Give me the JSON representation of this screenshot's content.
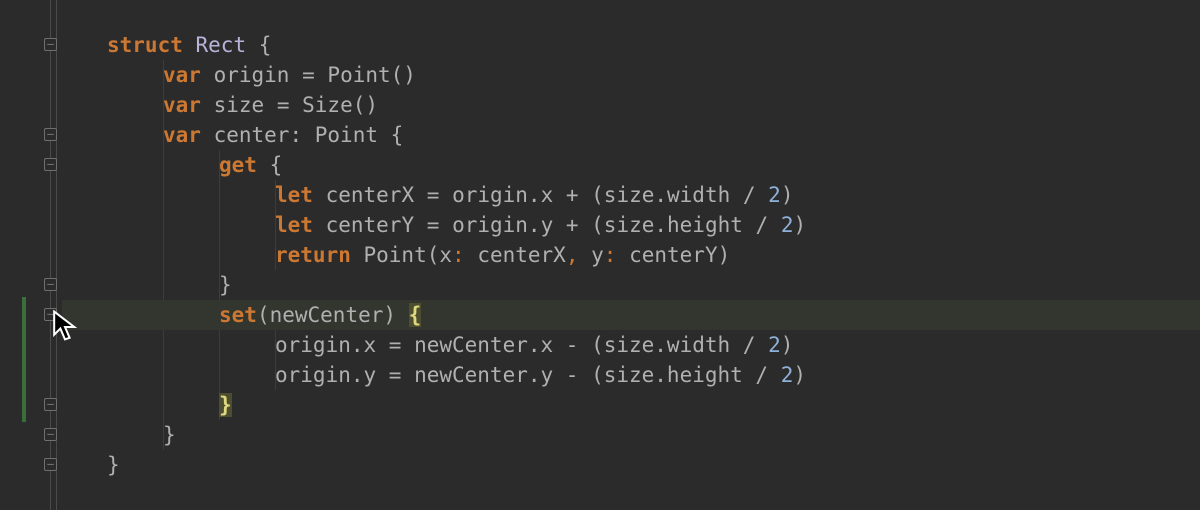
{
  "code": {
    "l1_struct": "struct",
    "l1_type": "Rect",
    "l1_brace": "{",
    "l2_var": "var",
    "l2_name": "origin",
    "l2_eq": "=",
    "l2_call": "Point()",
    "l3_var": "var",
    "l3_name": "size",
    "l3_eq": "=",
    "l3_call": "Size()",
    "l4_var": "var",
    "l4_name": "center",
    "l4_colon": ":",
    "l4_type": "Point",
    "l4_brace": "{",
    "l5_get": "get",
    "l5_brace": "{",
    "l6_let": "let",
    "l6_name": "centerX",
    "l6_eq": "=",
    "l6_expr": "origin.x + (size.width / ",
    "l6_num": "2",
    "l6_close": ")",
    "l7_let": "let",
    "l7_name": "centerY",
    "l7_eq": "=",
    "l7_expr": "origin.y + (size.height / ",
    "l7_num": "2",
    "l7_close": ")",
    "l8_return": "return",
    "l8_expr1": " Point(x",
    "l8_c1": ":",
    "l8_expr2": " centerX",
    "l8_comma": ",",
    "l8_expr3": " y",
    "l8_c2": ":",
    "l8_expr4": " centerY)",
    "l9_brace": "}",
    "l10_set": "set",
    "l10_args": "(newCenter) ",
    "l10_brace": "{",
    "l11_expr_a": "origin.x = newCenter.x - (size.width / ",
    "l11_num": "2",
    "l11_close": ")",
    "l12_expr_a": "origin.y = newCenter.y - (size.height / ",
    "l12_num": "2",
    "l12_close": ")",
    "l13_brace": "}",
    "l14_brace": "}",
    "l15_brace": "}"
  }
}
